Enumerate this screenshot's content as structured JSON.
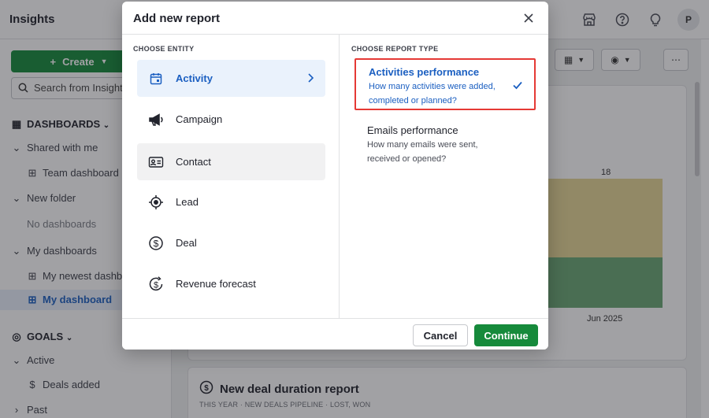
{
  "app": {
    "title": "Insights",
    "avatar_initial": "P",
    "top_icons": [
      "store-icon",
      "help-icon",
      "lightbulb-icon"
    ]
  },
  "sidebar": {
    "create_label": "Create",
    "search_placeholder": "Search from Insights",
    "dashboards_header": "DASHBOARDS",
    "shared_with_me": "Shared with me",
    "team_dashboard": "Team dashboard",
    "new_folder": "New folder",
    "no_dashboards": "No dashboards",
    "my_dashboards": "My dashboards",
    "my_newest_dashboard": "My newest dashboard",
    "my_dashboard": "My dashboard",
    "goals_header": "GOALS",
    "active": "Active",
    "deals_added": "Deals added",
    "past": "Past"
  },
  "main": {
    "chart_value_label": "18",
    "chart_x_label": "Jun 2025",
    "card2_title": "New deal duration report",
    "card2_filters": "THIS YEAR  ·  NEW DEALS PIPELINE  ·  LOST, WON"
  },
  "modal": {
    "title": "Add new report",
    "entity_header": "CHOOSE ENTITY",
    "report_type_header": "CHOOSE REPORT TYPE",
    "entities": [
      {
        "label": "Activity",
        "icon": "calendar-icon",
        "state": "selected"
      },
      {
        "label": "Campaign",
        "icon": "megaphone-icon",
        "state": "normal"
      },
      {
        "label": "Contact",
        "icon": "contact-card-icon",
        "state": "hover"
      },
      {
        "label": "Lead",
        "icon": "target-icon",
        "state": "normal"
      },
      {
        "label": "Deal",
        "icon": "dollar-icon",
        "state": "normal"
      },
      {
        "label": "Revenue forecast",
        "icon": "revenue-forecast-icon",
        "state": "normal"
      }
    ],
    "report_types": [
      {
        "title": "Activities performance",
        "description": "How many activities were added, completed or planned?",
        "selected": true
      },
      {
        "title": "Emails performance",
        "description": "How many emails were sent, received or opened?",
        "selected": false
      }
    ],
    "cancel_label": "Cancel",
    "continue_label": "Continue"
  },
  "colors": {
    "primary_green": "#168a3b",
    "selected_blue": "#1b5fc1",
    "selected_bg": "#eaf2fc",
    "highlight_red": "#e53935"
  }
}
